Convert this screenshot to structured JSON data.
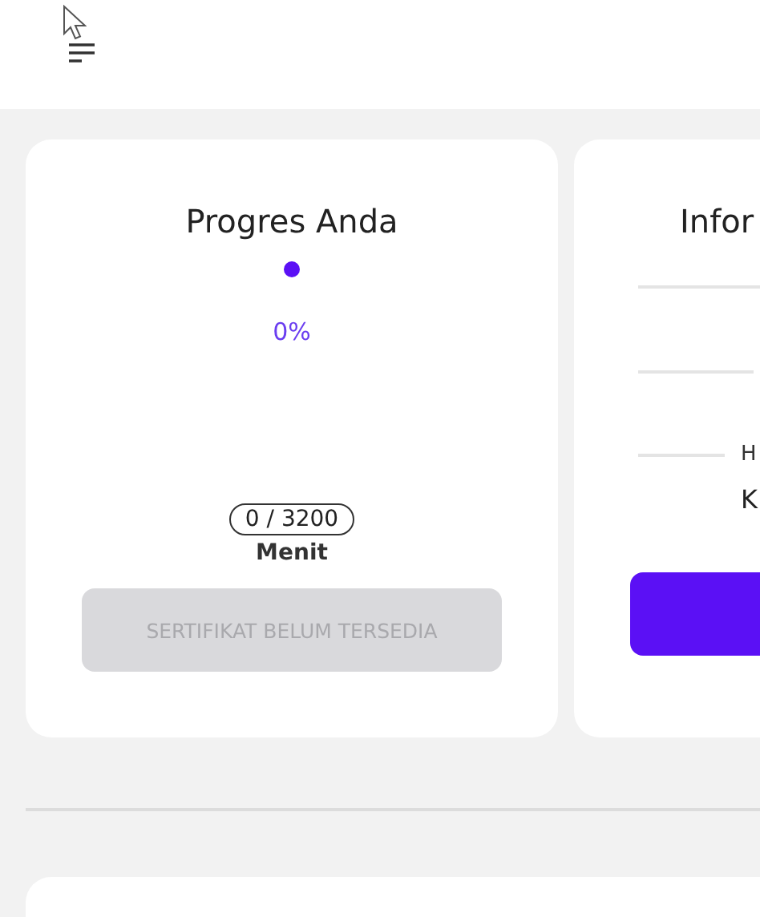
{
  "progress_card": {
    "title": "Progres Anda",
    "level": 0,
    "percent": "0%",
    "minutes": "0 / 3200",
    "unit": "Menit",
    "certificate_button": {
      "label": "SERTIFIKAT BELUM TERSEDIA",
      "disabled": true
    }
  },
  "info_card": {
    "title": "Infor",
    "row_label": "H",
    "row_value": "K"
  }
}
